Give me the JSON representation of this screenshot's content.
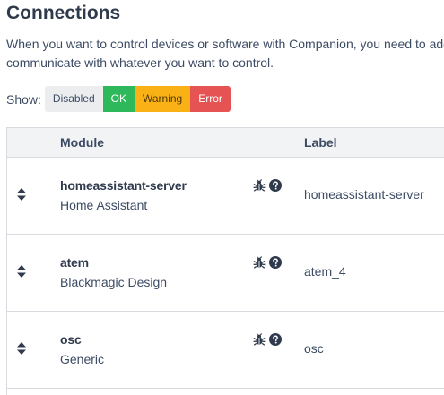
{
  "page": {
    "title": "Connections",
    "intro_line1": "When you want to control devices or software with Companion, you need to add",
    "intro_line2": "communicate with whatever you want to control."
  },
  "filter": {
    "label": "Show:",
    "buttons": [
      "Disabled",
      "OK",
      "Warning",
      "Error"
    ]
  },
  "colors": {
    "ok": "#2eb85c",
    "warning": "#f9b115",
    "error": "#e55353",
    "disabled": "#ebedef"
  },
  "table": {
    "headers": {
      "module": "Module",
      "label": "Label"
    },
    "rows": [
      {
        "module": "homeassistant-server",
        "vendor": "Home Assistant",
        "label": "homeassistant-server"
      },
      {
        "module": "atem",
        "vendor": "Blackmagic Design",
        "label": "atem_4"
      },
      {
        "module": "osc",
        "vendor": "Generic",
        "label": "osc"
      }
    ]
  },
  "icons": {
    "sort": "sort-icon",
    "debug": "bug-icon",
    "help": "question-circle-icon"
  }
}
